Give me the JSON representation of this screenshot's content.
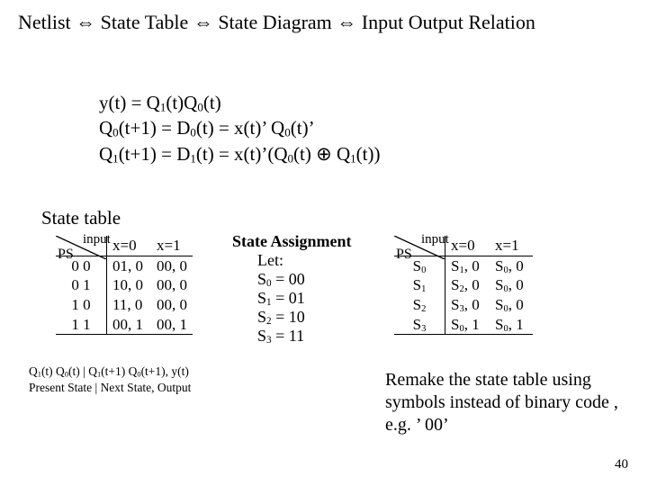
{
  "header": {
    "t1": "Netlist ",
    "a": "⇔",
    "t2": " State Table ",
    "t3": " State Diagram ",
    "t4": " Input Output Relation"
  },
  "eq": {
    "l1a": "y(t)  =  Q",
    "l1s1": "1",
    "l1b": "(t)Q",
    "l1s2": "0",
    "l1c": "(t)",
    "l2a": "Q",
    "l2s1": "0",
    "l2b": "(t+1) =  D",
    "l2s2": "0",
    "l2c": "(t) = x(t)’ Q",
    "l2s3": "0",
    "l2d": "(t)’",
    "l3a": "Q",
    "l3s1": "1",
    "l3b": "(t+1) =  D",
    "l3s2": "1",
    "l3c": "(t) = x(t)’(Q",
    "l3s3": "0",
    "l3d": "(t) ⊕ Q",
    "l3s4": "1",
    "l3e": "(t))"
  },
  "sect": "State table",
  "tblL": {
    "ps": "PS",
    "input": "input",
    "c0": "x=0",
    "c1": "x=1",
    "r": [
      [
        "0 0",
        "01, 0",
        "00, 0"
      ],
      [
        "0 1",
        "10, 0",
        "00, 0"
      ],
      [
        "1 0",
        "11, 0",
        "00, 0"
      ],
      [
        "1 1",
        "00, 1",
        "00, 1"
      ]
    ]
  },
  "assign": {
    "title": "State Assignment",
    "let": "Let:",
    "r0a": "S",
    "r0s": "0",
    "r0b": " = 00",
    "r1a": "S",
    "r1s": "1",
    "r1b": " = 01",
    "r2a": "S",
    "r2s": "2",
    "r2b": " = 10",
    "r3a": "S",
    "r3s": "3",
    "r3b": " = 11"
  },
  "tblR": {
    "ps": "PS",
    "input": "input",
    "c0": "x=0",
    "c1": "x=1",
    "rows": [
      {
        "ps": "S",
        "pss": "0",
        "a": "S",
        "as": "1",
        "at": ", 0",
        "b": "S",
        "bs": "0",
        "bt": ", 0"
      },
      {
        "ps": "S",
        "pss": "1",
        "a": "S",
        "as": "2",
        "at": ", 0",
        "b": "S",
        "bs": "0",
        "bt": ", 0"
      },
      {
        "ps": "S",
        "pss": "2",
        "a": "S",
        "as": "3",
        "at": ", 0",
        "b": "S",
        "bs": "0",
        "bt": ", 0"
      },
      {
        "ps": "S",
        "pss": "3",
        "a": "S",
        "as": "0",
        "at": ", 1",
        "b": "S",
        "bs": "0",
        "bt": ", 1"
      }
    ]
  },
  "legend": {
    "l1a": "Q",
    "l1s1": "1",
    "l1b": "(t) Q",
    "l1s2": "0",
    "l1c": "(t)   | Q",
    "l1s3": "1",
    "l1d": "(t+1) Q",
    "l1s4": "0",
    "l1e": "(t+1), y(t)",
    "l2": "Present State | Next State, Output"
  },
  "note": "Remake the state table using symbols instead of binary code , e.g. ’ 00’",
  "pageno": "40"
}
